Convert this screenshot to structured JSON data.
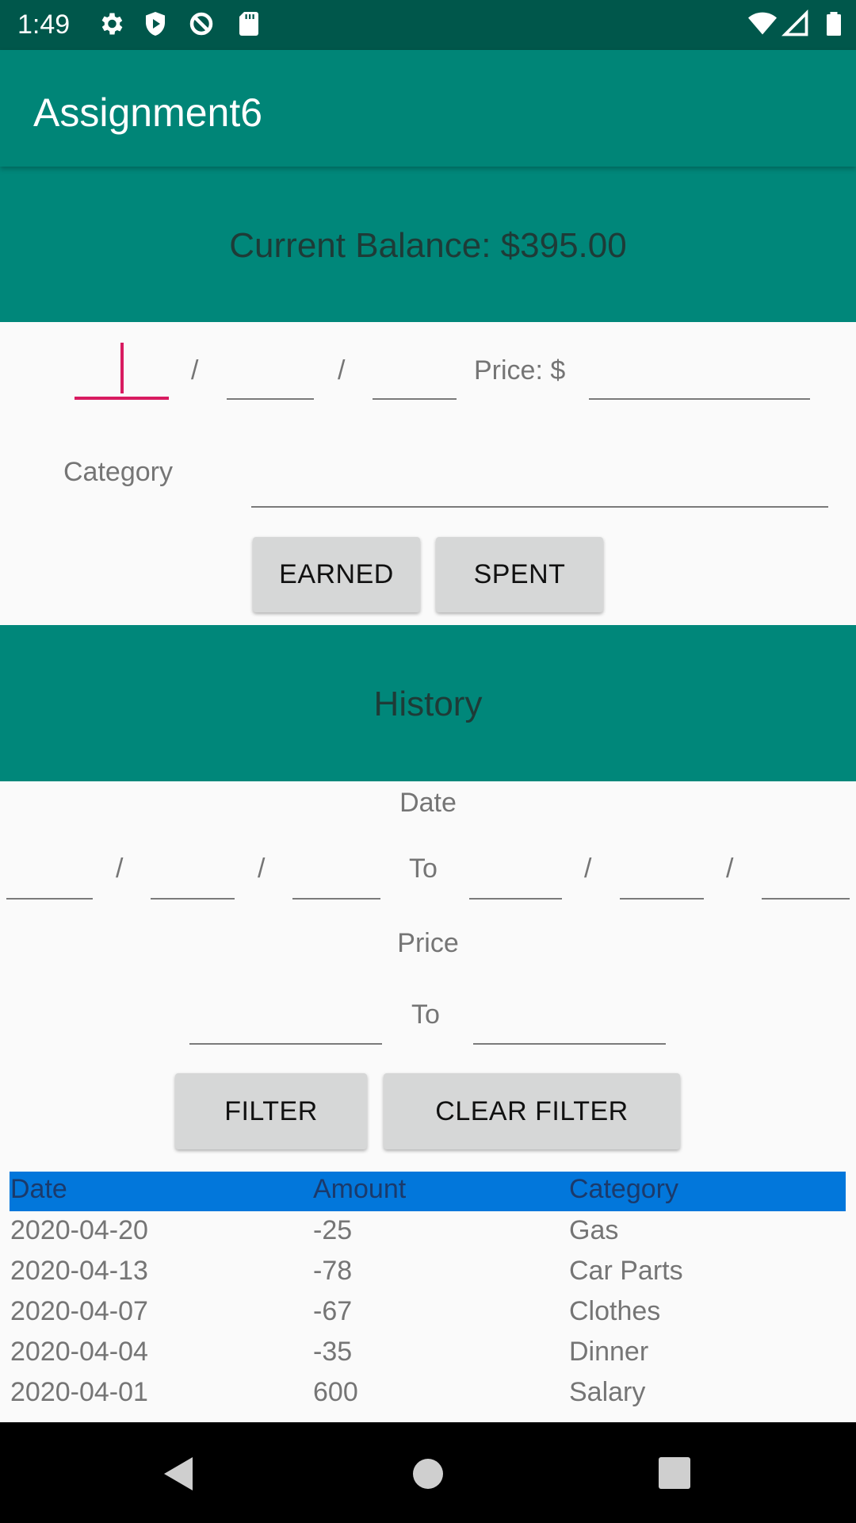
{
  "status_bar": {
    "time": "1:49",
    "icons": [
      "settings-gear-icon",
      "shield-play-icon",
      "data-saver-icon",
      "sd-card-icon",
      "wifi-icon",
      "cell-signal-icon",
      "battery-icon"
    ]
  },
  "app_bar": {
    "title": "Assignment6"
  },
  "balance": {
    "label": "Current Balance: $395.00"
  },
  "entry_form": {
    "date_separator_1": "/",
    "date_separator_2": "/",
    "price_label": "Price: $",
    "category_label": "Category",
    "earned_button": "EARNED",
    "spent_button": "SPENT"
  },
  "history": {
    "title": "History"
  },
  "filter": {
    "date_label": "Date",
    "sep1": "/",
    "sep2": "/",
    "to_label": "To",
    "sep3": "/",
    "sep4": "/",
    "price_label": "Price",
    "price_to_label": "To",
    "filter_button": "FILTER",
    "clear_filter_button": "CLEAR FILTER"
  },
  "table": {
    "headers": [
      "Date",
      "Amount",
      "Category"
    ],
    "rows": [
      [
        "2020-04-20",
        "-25",
        "Gas"
      ],
      [
        "2020-04-13",
        "-78",
        "Car Parts"
      ],
      [
        "2020-04-07",
        "-67",
        "Clothes"
      ],
      [
        "2020-04-04",
        "-35",
        "Dinner"
      ],
      [
        "2020-04-01",
        "600",
        "Salary"
      ]
    ]
  },
  "colors": {
    "primary": "#008577",
    "primary_dark": "#00574b",
    "accent": "#d81b60",
    "table_header": "#0277db"
  }
}
